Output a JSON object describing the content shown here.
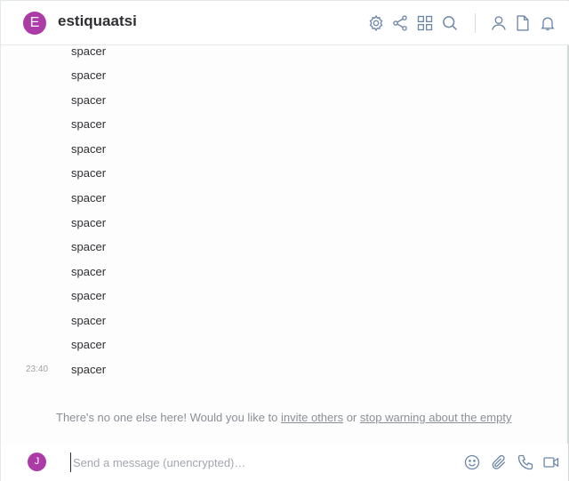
{
  "room": {
    "avatar_letter": "E",
    "name": "estiquaatsi"
  },
  "header_icons": [
    "gear-icon",
    "share-icon",
    "apps-grid-icon",
    "search-icon",
    "person-icon",
    "file-icon",
    "bell-icon"
  ],
  "timeline": {
    "messages": [
      {
        "text": "spacer",
        "time": ""
      },
      {
        "text": "spacer",
        "time": ""
      },
      {
        "text": "spacer",
        "time": ""
      },
      {
        "text": "spacer",
        "time": ""
      },
      {
        "text": "spacer",
        "time": ""
      },
      {
        "text": "spacer",
        "time": ""
      },
      {
        "text": "spacer",
        "time": ""
      },
      {
        "text": "spacer",
        "time": ""
      },
      {
        "text": "spacer",
        "time": ""
      },
      {
        "text": "spacer",
        "time": ""
      },
      {
        "text": "spacer",
        "time": ""
      },
      {
        "text": "spacer",
        "time": ""
      },
      {
        "text": "spacer",
        "time": ""
      },
      {
        "text": "spacer",
        "time": "23:40"
      }
    ]
  },
  "notice": {
    "prefix": "There's no one else here! Would you like to ",
    "invite_link": "invite others",
    "middle": " or ",
    "stop_link": "stop warning about the empty"
  },
  "composer": {
    "avatar_letter": "J",
    "placeholder": "Send a message (unencrypted)…",
    "icons": [
      "emoji-icon",
      "paperclip-icon",
      "phone-icon",
      "video-icon"
    ]
  },
  "colors": {
    "avatar": "#ac3ba8",
    "icon": "#6d87a8"
  }
}
